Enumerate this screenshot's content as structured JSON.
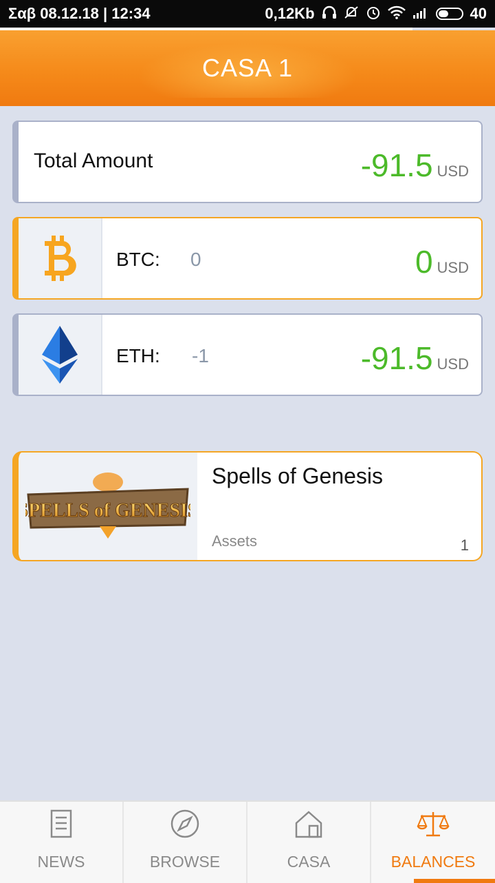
{
  "status_bar": {
    "datetime": "Σαβ 08.12.18 | 12:34",
    "net_speed": "0,12Kb",
    "battery_level": "40"
  },
  "header": {
    "title": "CASA 1"
  },
  "total": {
    "label": "Total Amount",
    "value": "-91.5",
    "unit": "USD"
  },
  "coins": [
    {
      "symbol": "BTC:",
      "quantity": "0",
      "value": "0",
      "unit": "USD",
      "icon": "bitcoin-icon"
    },
    {
      "symbol": "ETH:",
      "quantity": "-1",
      "value": "-91.5",
      "unit": "USD",
      "icon": "ethereum-icon"
    }
  ],
  "game": {
    "name": "Spells of Genesis",
    "assets_label": "Assets",
    "assets_count": "1",
    "logo_text": "SPELLS of GENESIS"
  },
  "nav": {
    "items": [
      {
        "label": "NEWS",
        "icon": "news-icon"
      },
      {
        "label": "BROWSE",
        "icon": "compass-icon"
      },
      {
        "label": "CASA",
        "icon": "home-icon"
      },
      {
        "label": "BALANCES",
        "icon": "scales-icon"
      }
    ],
    "active": "BALANCES"
  },
  "colors": {
    "accent": "#f07a10",
    "positive": "#4cba2a",
    "border": "#a9b1c9",
    "bitcoin": "#f5a623",
    "ethereum": "#1f5fc4"
  }
}
